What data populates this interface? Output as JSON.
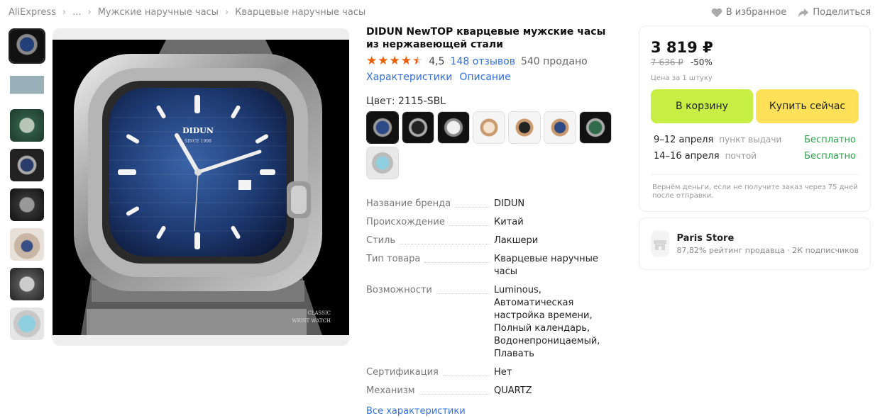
{
  "breadcrumb": {
    "items": [
      "AliExpress",
      "...",
      "Мужские наручные часы",
      "Кварцевые наручные часы"
    ]
  },
  "actions": {
    "favorite": "В избранное",
    "share": "Поделиться"
  },
  "product": {
    "title": "DIDUN NewTOP кварцевые мужские часы из нержавеющей стали",
    "rating": "4,5",
    "reviews": "148 отзывов",
    "sold": "540 продано",
    "tab_specs": "Характеристики",
    "tab_desc": "Описание",
    "color_label": "Цвет: 2115-SBL",
    "image_text": {
      "brand": "DIDUN",
      "since": "SINCE 1998",
      "classic": "CLASSIC",
      "wrist": "WRIST WATCH"
    }
  },
  "specs": [
    {
      "key": "Название бренда",
      "value": "DIDUN"
    },
    {
      "key": "Происхождение",
      "value": "Китай"
    },
    {
      "key": "Стиль",
      "value": "Лакшери"
    },
    {
      "key": "Тип товара",
      "value": "Кварцевые наручные часы"
    },
    {
      "key": "Возможности",
      "value": "Luminous, Автоматическая настройка времени, Полный календарь, Водонепроницаемый, Плавать"
    },
    {
      "key": "Сертификация",
      "value": "Нет"
    },
    {
      "key": "Механизм",
      "value": "QUARTZ"
    }
  ],
  "all_specs": "Все характеристики",
  "buy": {
    "price": "3 819 ₽",
    "old_price": "7 636 ₽",
    "discount": "-50%",
    "unit": "Цена за 1 штуку",
    "cart_btn": "В корзину",
    "buy_btn": "Купить сейчас",
    "delivery": [
      {
        "date": "9–12 апреля",
        "method": "пункт выдачи",
        "cost": "Бесплатно"
      },
      {
        "date": "14–16 апреля",
        "method": "почтой",
        "cost": "Бесплатно"
      }
    ],
    "refund": "Вернём деньги, если не получите заказ через 75 дней после отправки."
  },
  "store": {
    "name": "Paris Store",
    "rating": "87,82% рейтинг продавца",
    "followers": "2К подписчиков"
  },
  "colors": {
    "accent": "#2f6fe0",
    "cart": "#c6ee45",
    "buy": "#ffe159",
    "star": "#f25c05",
    "free": "#2aa34a"
  }
}
